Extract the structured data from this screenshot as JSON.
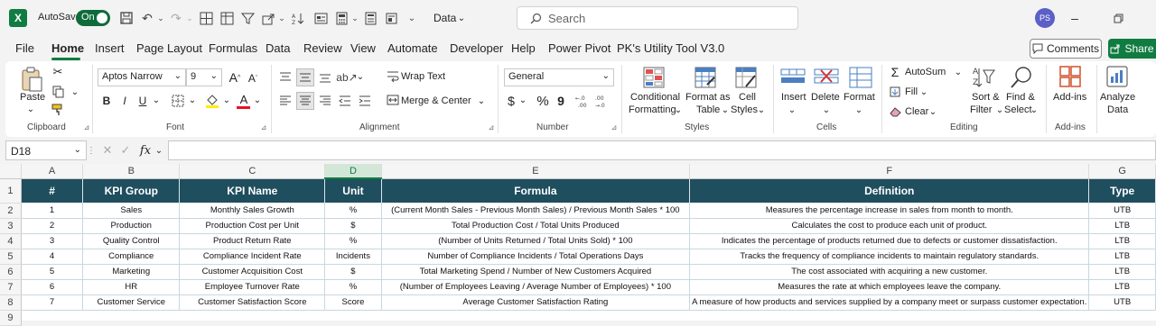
{
  "titlebar": {
    "autosave_label": "AutoSave",
    "autosave_state": "On",
    "doc_dropdown": "Data",
    "search_placeholder": "Search",
    "avatar_initials": "PS"
  },
  "menu": {
    "items": [
      "File",
      "Home",
      "Insert",
      "Page Layout",
      "Formulas",
      "Data",
      "Review",
      "View",
      "Automate",
      "Developer",
      "Help",
      "Power Pivot",
      "PK's Utility Tool V3.0"
    ],
    "active": "Home",
    "comments_label": "Comments",
    "share_label": "Share"
  },
  "ribbon": {
    "clipboard": {
      "paste": "Paste",
      "group": "Clipboard"
    },
    "font": {
      "name": "Aptos Narrow",
      "size": "9",
      "bold": "B",
      "italic": "I",
      "underline": "U",
      "grow": "A",
      "shrink": "A",
      "font_color_letter": "A",
      "group": "Font"
    },
    "alignment": {
      "wrap": "Wrap Text",
      "merge": "Merge & Center",
      "group": "Alignment"
    },
    "number": {
      "format": "General",
      "currency": "$",
      "percent": "%",
      "comma": "9",
      "group": "Number"
    },
    "styles": {
      "conditional_1": "Conditional",
      "conditional_2": "Formatting",
      "format_table_1": "Format as",
      "format_table_2": "Table",
      "cell_styles_1": "Cell",
      "cell_styles_2": "Styles",
      "group": "Styles"
    },
    "cells": {
      "insert": "Insert",
      "delete": "Delete",
      "format": "Format",
      "group": "Cells"
    },
    "editing": {
      "autosum": "AutoSum",
      "fill": "Fill",
      "clear": "Clear",
      "sort_1": "Sort &",
      "sort_2": "Filter",
      "find_1": "Find &",
      "find_2": "Select",
      "group": "Editing"
    },
    "addins": {
      "label": "Add-ins",
      "group": "Add-ins"
    },
    "analyze": {
      "label_1": "Analyze",
      "label_2": "Data"
    }
  },
  "formula_bar": {
    "name_box": "D18",
    "fx": "fx",
    "value": ""
  },
  "sheet": {
    "columns": [
      "A",
      "B",
      "C",
      "D",
      "E",
      "F",
      "G"
    ],
    "selected_column": "D",
    "row_numbers": [
      "1",
      "2",
      "3",
      "4",
      "5",
      "6",
      "7",
      "8",
      "9"
    ],
    "headers": [
      "#",
      "KPI Group",
      "KPI Name",
      "Unit",
      "Formula",
      "Definition",
      "Type"
    ],
    "rows": [
      [
        "1",
        "Sales",
        "Monthly Sales Growth",
        "%",
        "(Current Month Sales - Previous Month Sales) / Previous Month Sales * 100",
        "Measures the percentage increase in sales from month to month.",
        "UTB"
      ],
      [
        "2",
        "Production",
        "Production Cost per Unit",
        "$",
        "Total Production Cost / Total Units Produced",
        "Calculates the cost to produce each unit of product.",
        "LTB"
      ],
      [
        "3",
        "Quality Control",
        "Product Return Rate",
        "%",
        "(Number of Units Returned / Total Units Sold) * 100",
        "Indicates the percentage of products returned due to defects or customer dissatisfaction.",
        "LTB"
      ],
      [
        "4",
        "Compliance",
        "Compliance Incident Rate",
        "Incidents",
        "Number of Compliance Incidents / Total Operations Days",
        "Tracks the frequency of compliance incidents to maintain regulatory standards.",
        "LTB"
      ],
      [
        "5",
        "Marketing",
        "Customer Acquisition Cost",
        "$",
        "Total Marketing Spend / Number of New Customers Acquired",
        "The cost associated with acquiring a new customer.",
        "LTB"
      ],
      [
        "6",
        "HR",
        "Employee Turnover Rate",
        "%",
        "(Number of Employees Leaving / Average Number of Employees) * 100",
        "Measures the rate at which employees leave the company.",
        "LTB"
      ],
      [
        "7",
        "Customer Service",
        "Customer Satisfaction Score",
        "Score",
        "Average Customer Satisfaction Rating",
        "A measure of how products and services supplied by a company meet or surpass customer expectation.",
        "UTB"
      ]
    ]
  },
  "colors": {
    "accent": "#107c41",
    "header_fill": "#1f4e5f"
  }
}
